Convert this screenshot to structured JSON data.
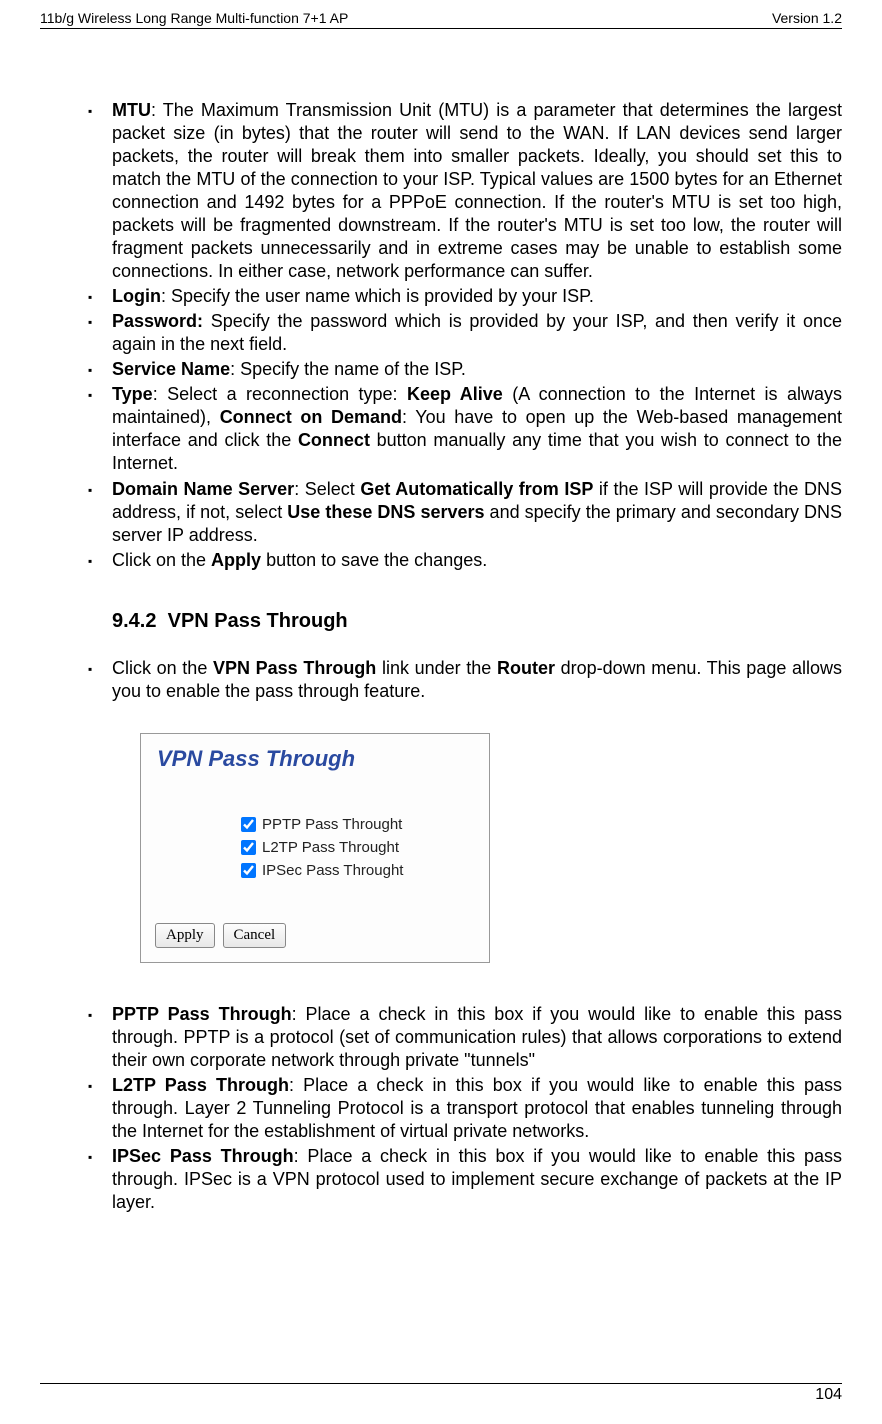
{
  "header": {
    "left": "11b/g Wireless Long Range Multi-function 7+1 AP",
    "right": "Version 1.2"
  },
  "bullets_top": [
    {
      "label": "MTU",
      "text": ": The Maximum Transmission Unit (MTU) is a parameter that determines the largest packet size (in bytes) that the router will send to the WAN. If LAN devices send larger packets, the router will break them into smaller packets. Ideally, you should set this to match the MTU of the connection to your ISP. Typical values are 1500 bytes for an Ethernet connection and 1492 bytes for a PPPoE connection. If the router's MTU is set too high, packets will be fragmented downstream. If the router's MTU is set too low, the router will fragment packets unnecessarily and in extreme cases may be unable to establish some connections. In either case, network performance can suffer."
    },
    {
      "label": "Login",
      "text": ": Specify the user name which is provided by your ISP."
    },
    {
      "label": "Password:",
      "text": " Specify the password which is provided by your ISP, and then verify it once again in the next field."
    },
    {
      "label": "Service Name",
      "text": ": Specify the name of the ISP."
    }
  ],
  "type_bullet": {
    "label": "Type",
    "pre": ": Select a reconnection type: ",
    "b1": "Keep Alive",
    "mid1": "  (A connection to the Internet is always maintained), ",
    "b2": "Connect on Demand",
    "mid2": ": You have to open up the Web-based management interface and click the ",
    "b3": "Connect",
    "post": " button manually any time that you wish to connect to the Internet."
  },
  "dns_bullet": {
    "label": "Domain Name Server",
    "pre": ": Select ",
    "b1": "Get Automatically from ISP",
    "mid": " if the ISP will provide the DNS address, if not, select ",
    "b2": "Use these DNS servers",
    "post": " and specify the primary and secondary DNS server IP address."
  },
  "apply_bullet": {
    "pre": "Click on the ",
    "b1": "Apply",
    "post": " button to save the changes."
  },
  "section": {
    "number": "9.4.2",
    "title": "VPN Pass Through"
  },
  "vpn_intro": {
    "pre": "Click on the ",
    "b1": "VPN Pass Through",
    "mid": " link under the ",
    "b2": "Router",
    "post": " drop-down menu. This page allows you to enable the pass through feature."
  },
  "vpn_box": {
    "title": "VPN Pass Through",
    "checks": [
      {
        "label": "PPTP Pass Throught",
        "checked": true
      },
      {
        "label": "L2TP Pass Throught",
        "checked": true
      },
      {
        "label": "IPSec Pass Throught",
        "checked": true
      }
    ],
    "apply": "Apply",
    "cancel": "Cancel"
  },
  "bullets_bottom": [
    {
      "label": "PPTP Pass Through",
      "text": ": Place a check in this box if you would like to enable this pass through. PPTP is a protocol (set of communication rules) that allows corporations to extend their own corporate network through private \"tunnels\""
    },
    {
      "label": "L2TP Pass Through",
      "text": ": Place a check in this box if you would like to enable this pass through. Layer 2 Tunneling Protocol is a transport protocol that enables tunneling through the Internet for the establishment of virtual private networks."
    },
    {
      "label": "IPSec Pass Through",
      "text": ": Place a check in this box if you would like to enable this pass through. IPSec is a VPN protocol used to implement secure exchange of packets at the IP layer."
    }
  ],
  "footer": {
    "page": "104"
  }
}
